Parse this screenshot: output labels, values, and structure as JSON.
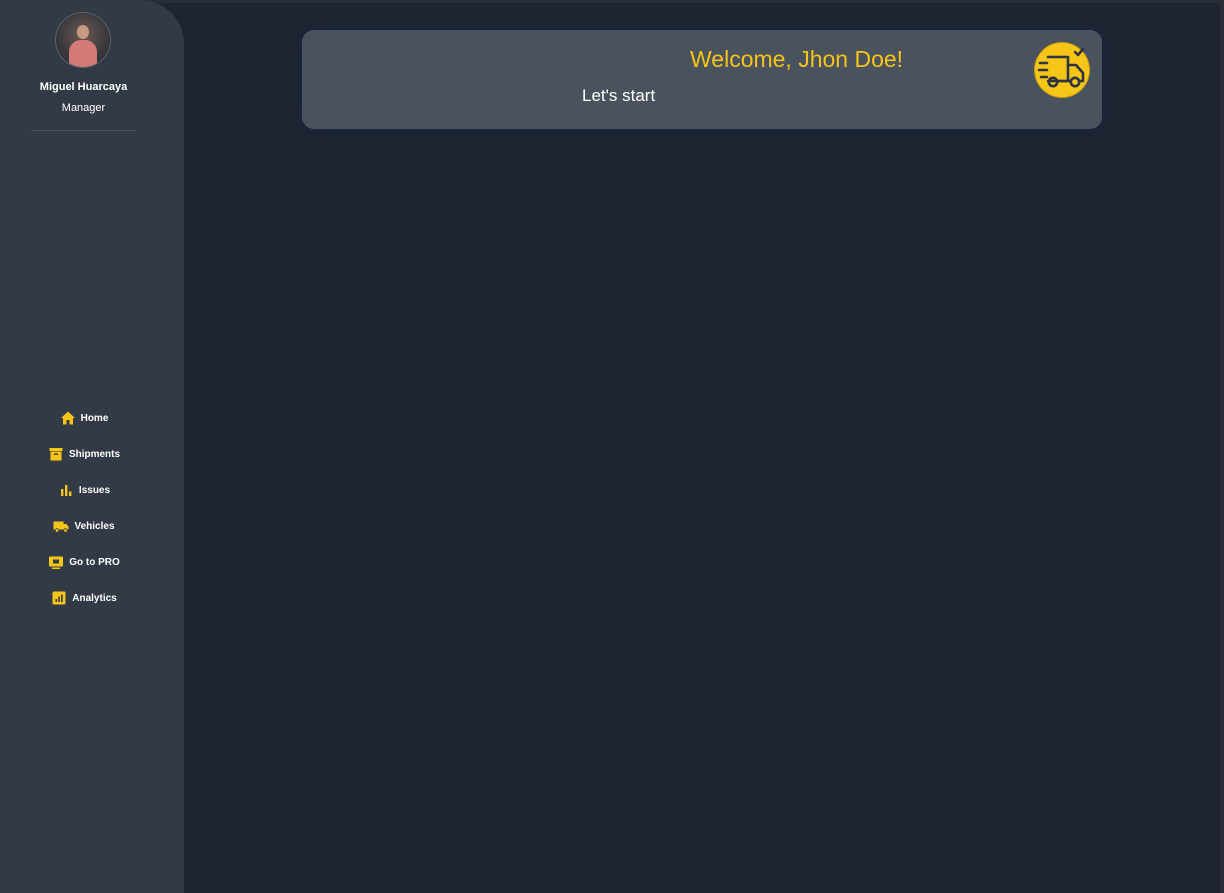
{
  "user": {
    "name": "Miguel Huarcaya",
    "role": "Manager"
  },
  "nav": {
    "items": [
      {
        "label": "Home",
        "icon": "home-icon"
      },
      {
        "label": "Shipments",
        "icon": "archive-box-icon"
      },
      {
        "label": "Issues",
        "icon": "bar-chart-icon"
      },
      {
        "label": "Vehicles",
        "icon": "truck-icon"
      },
      {
        "label": "Go to PRO",
        "icon": "monitor-icon"
      },
      {
        "label": "Analytics",
        "icon": "analytics-icon"
      }
    ]
  },
  "welcome_card": {
    "title": "Welcome, Jhon Doe!",
    "subtitle": "Let's start",
    "icon": "fast-delivery-truck-icon"
  },
  "colors": {
    "accent": "#f5c518",
    "sidebar": "#323a45",
    "background": "#1e2530",
    "card": "#4a525d"
  }
}
